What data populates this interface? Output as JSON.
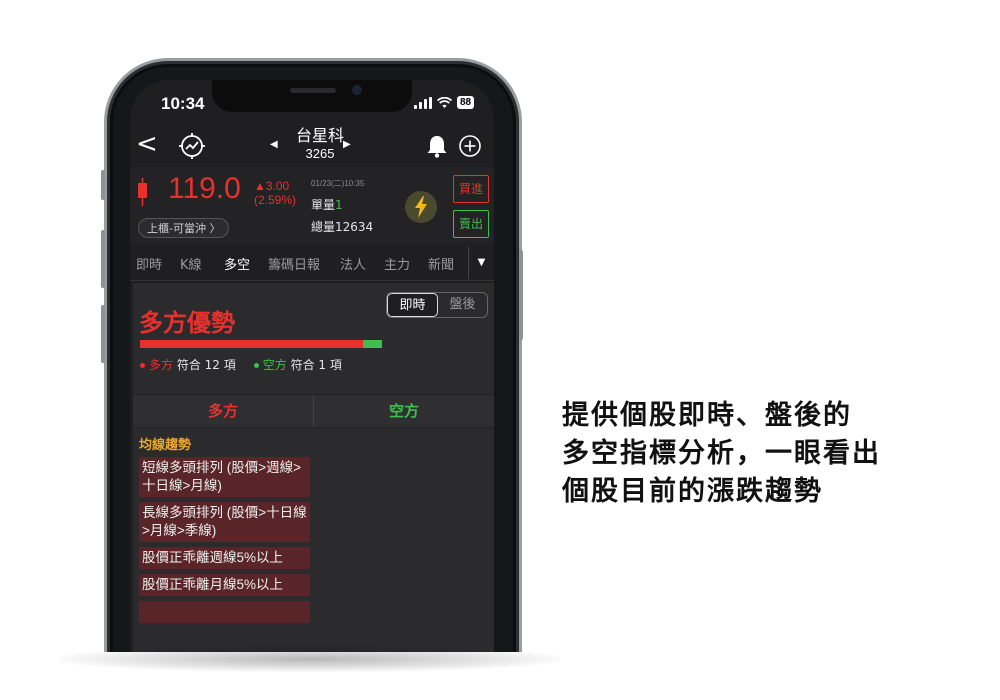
{
  "status_bar": {
    "time": "10:34",
    "battery": "88"
  },
  "nav": {
    "stock_name": "台星科",
    "stock_code": "3265"
  },
  "quote": {
    "price": "119.0",
    "change": "▲3.00",
    "change_pct": "(2.59%)",
    "datetime": "01/23(二)10:35",
    "unit_volume_label": "單量",
    "unit_volume_value": "1",
    "total_volume": "總量12634",
    "market_tag": "上櫃-可當沖 〉",
    "buy_label": "買進",
    "sell_label": "賣出"
  },
  "tabs": [
    "即時",
    "K線",
    "多空",
    "籌碼日報",
    "法人",
    "主力",
    "新聞"
  ],
  "active_tab": "多空",
  "panel": {
    "headline": "多方優勢",
    "toggle": [
      "即時",
      "盤後"
    ],
    "bull_fraction": 0.923,
    "bull_count_label": "多方",
    "bull_count_text": "符合 12 項",
    "bear_count_label": "空方",
    "bear_count_text": "符合 1 項",
    "col_bull": "多方",
    "col_bear": "空方",
    "section_title": "均線趨勢",
    "items": [
      "短線多頭排列 (股價>週線>十日線>月線)",
      "長線多頭排列 (股價>十日線>月線>季線)",
      "股價正乖離週線5%以上",
      "股價正乖離月線5%以上"
    ]
  },
  "caption": [
    "提供個股即時、盤後的",
    "多空指標分析，一眼看出",
    "個股目前的漲跌趨勢"
  ],
  "colors": {
    "up": "#e8302e",
    "down": "#3fbf4f",
    "accent": "#e8a82e"
  }
}
